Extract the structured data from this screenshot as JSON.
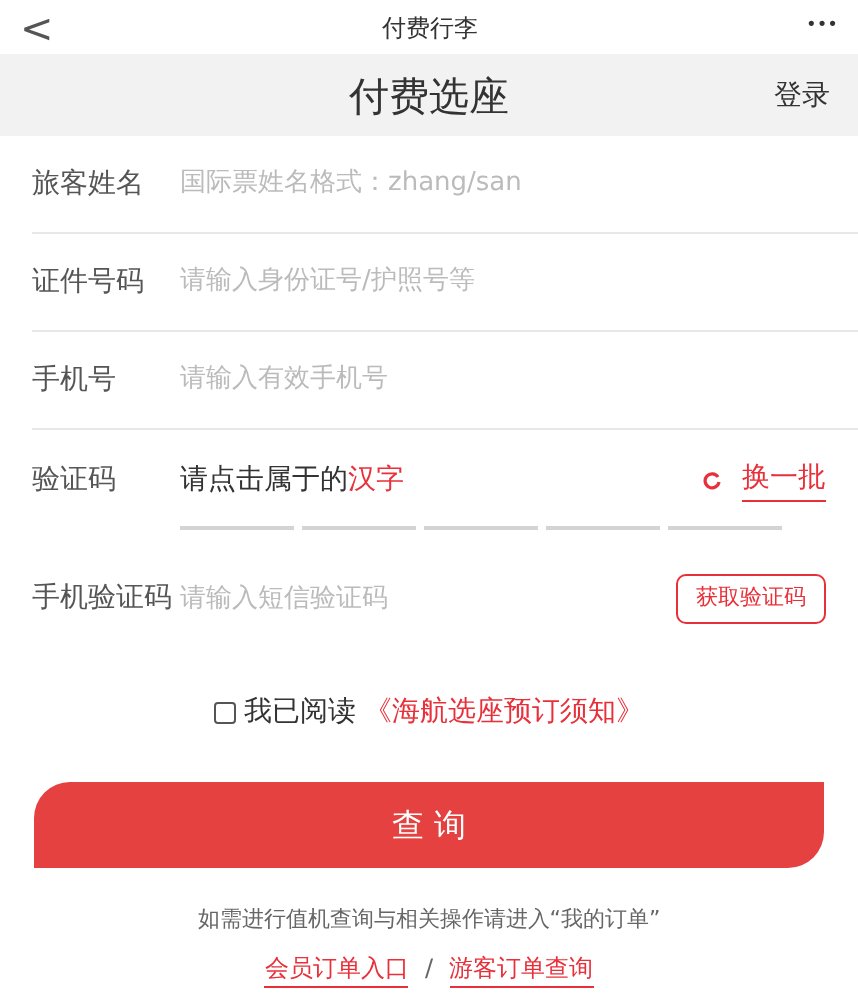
{
  "top_bar": {
    "back": "<",
    "title": "付费行李",
    "more": "•••"
  },
  "header": {
    "title": "付费选座",
    "login": "登录"
  },
  "fields": [
    {
      "kind": "input",
      "label": "旅客姓名",
      "placeholder": "国际票姓名格式：zhang/san"
    },
    {
      "kind": "input",
      "label": "证件号码",
      "placeholder": "请输入身份证号/护照号等"
    },
    {
      "kind": "input",
      "label": "手机号",
      "placeholder": "请输入有效手机号"
    },
    {
      "kind": "captcha",
      "label": "验证码",
      "prompt": "请点击属于的",
      "highlight": "汉字",
      "refresh": "换一批"
    },
    {
      "kind": "sms",
      "label": "手机验证码",
      "placeholder": "请输入短信验证码",
      "button": "获取验证码"
    }
  ],
  "agreement": {
    "checked": false,
    "text": "我已阅读",
    "link": "《海航选座预订须知》"
  },
  "submit": "查 询",
  "note": "如需进行值机查询与相关操作请进入“我的订单”",
  "links": [
    {
      "label": "会员订单入口"
    },
    {
      "label": "游客订单查询"
    }
  ],
  "link_separator": "/"
}
